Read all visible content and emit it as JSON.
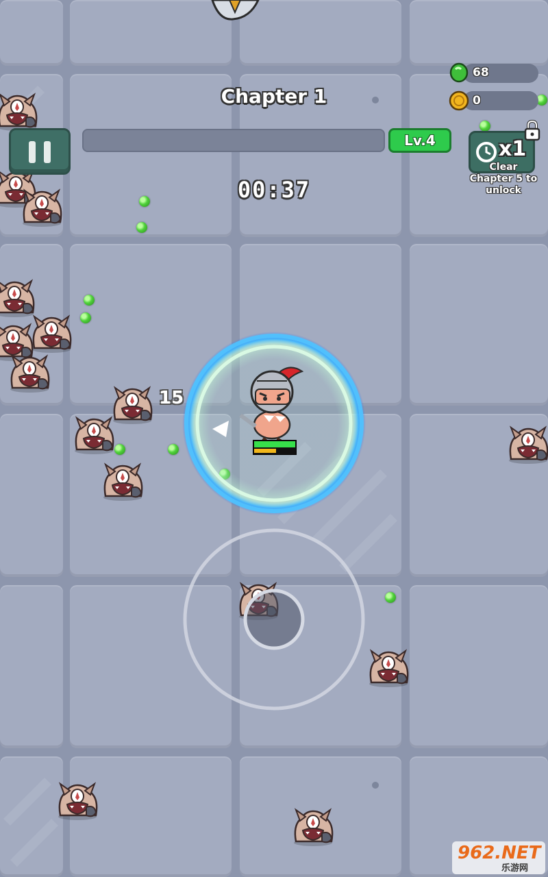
{
  "hud": {
    "chapter_title": "Chapter 1",
    "timer": "00:37",
    "level_label": "Lv.4",
    "pause_icon": "pause-icon"
  },
  "resources": {
    "gems": {
      "icon": "green-gem-icon",
      "value": "68"
    },
    "coins": {
      "icon": "gold-coin-icon",
      "value": "0"
    }
  },
  "speed": {
    "label": "x1",
    "icon": "speed-clock-icon",
    "lock_icon": "lock-icon",
    "unlock_line1": "Clear",
    "unlock_line2": "Chapter 5 to",
    "unlock_line3": "unlock"
  },
  "combat": {
    "damage_number": "15"
  },
  "colors": {
    "floor": "#a3abc0",
    "grout": "#8d96ad",
    "accent_green": "#2ecb4c",
    "button_teal": "#3f6f66",
    "shield_blue": "#3fb6ff"
  },
  "watermark": {
    "main": "962.NET",
    "sub": "乐游网"
  }
}
